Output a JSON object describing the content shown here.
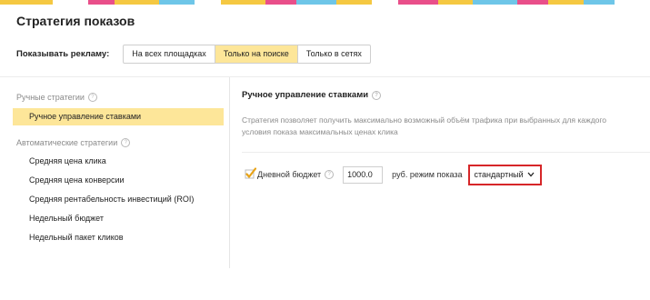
{
  "stripe_colors": [
    "#f5c842",
    "#e94f8a",
    "#6ec6e8",
    "#f5c842",
    "#e94f8a",
    "#6ec6e8"
  ],
  "title": "Стратегия показов",
  "show_ads": {
    "label": "Показывать рекламу:",
    "options": [
      "На всех площадках",
      "Только на поиске",
      "Только в сетях"
    ],
    "selected": "Только на поиске"
  },
  "sidebar": {
    "manual_group": "Ручные стратегии",
    "manual_items": [
      "Ручное управление ставками"
    ],
    "auto_group": "Автоматические стратегии",
    "auto_items": [
      "Средняя цена клика",
      "Средняя цена конверсии",
      "Средняя рентабельность инвестиций (ROI)",
      "Недельный бюджет",
      "Недельный пакет кликов"
    ]
  },
  "panel": {
    "title": "Ручное управление ставками",
    "description": "Стратегия позволяет получить максимально возможный объём трафика при выбранных для каждого условия показа максимальных ценах клика",
    "daily_budget_label": "Дневной бюджет",
    "daily_budget_checked": true,
    "daily_budget_value": "1000.0",
    "currency_mode_label": "руб. режим показа",
    "mode_value": "стандартный"
  },
  "colors": {
    "accent_yellow": "#fde699",
    "highlight_red": "#d62628",
    "check_orange": "#e8a317"
  }
}
